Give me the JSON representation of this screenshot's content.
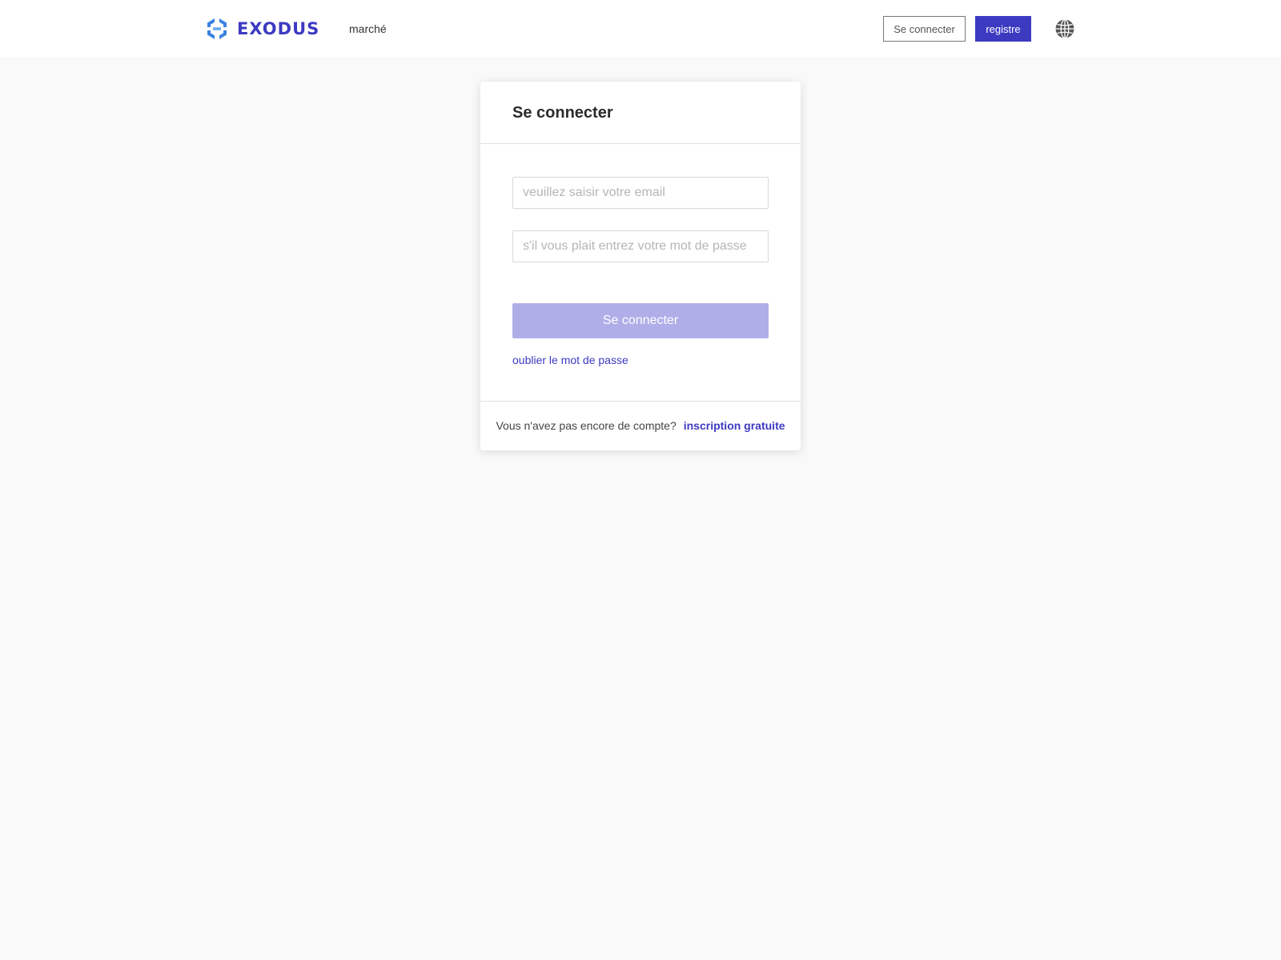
{
  "header": {
    "logo_text": "EXODUS",
    "nav_market": "marché",
    "login_button": "Se connecter",
    "register_button": "registre"
  },
  "login_card": {
    "title": "Se connecter",
    "email_placeholder": "veuillez saisir votre email",
    "password_placeholder": "s'il vous plait entrez votre mot de passe",
    "submit_label": "Se connecter",
    "forgot_password": "oublier le mot de passe",
    "no_account_text": "Vous n'avez pas encore de compte?",
    "signup_link": "inscription gratuite"
  },
  "colors": {
    "brand": "#3d3ac2",
    "logo_blue": "#3b82e0",
    "submit_disabled": "#b0aee8",
    "background": "#f9f9f9"
  },
  "icons": {
    "logo": "exodus-hexagon-logo",
    "language": "globe-icon"
  }
}
